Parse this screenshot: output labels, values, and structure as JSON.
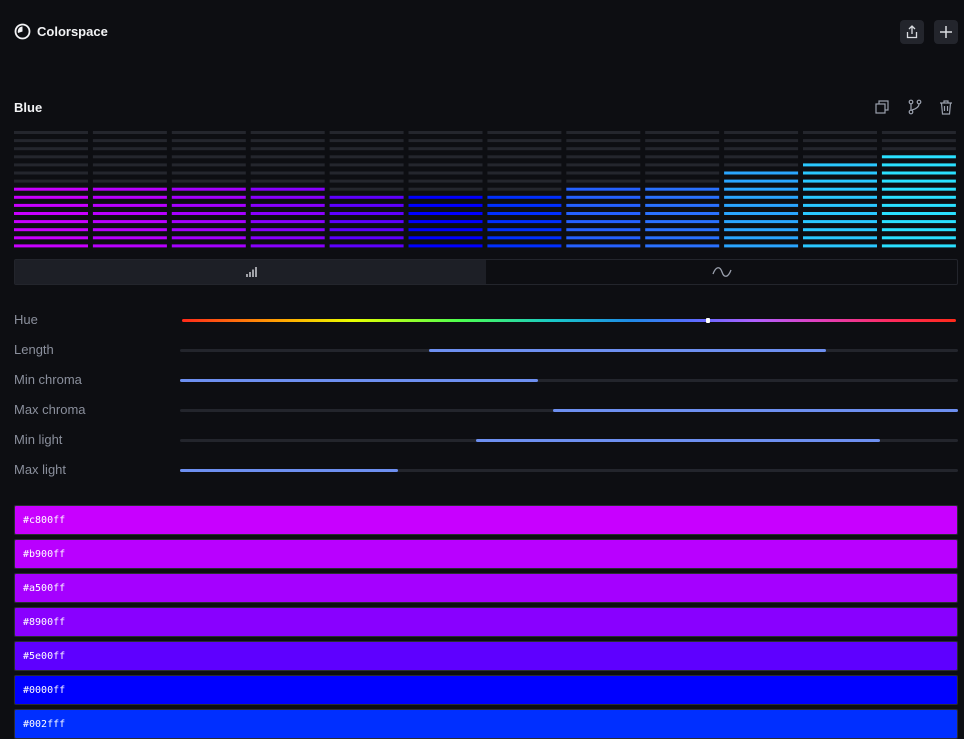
{
  "app": {
    "title": "Colorspace"
  },
  "toolbar": {
    "share_icon": "share-icon",
    "add_icon": "plus-icon"
  },
  "palette": {
    "name": "Blue",
    "tools": [
      "duplicate-icon",
      "fork-icon",
      "trash-icon"
    ],
    "colors": [
      "#c800ff",
      "#b900ff",
      "#a500ff",
      "#8900ff",
      "#5e00ff",
      "#0000ff",
      "#002fff",
      "#2561ff",
      "#2a71ff",
      "#2aa6ff",
      "#2ac8ff",
      "#2ae0ff"
    ],
    "levels": [
      0.55,
      0.55,
      0.55,
      0.5,
      0.45,
      0.45,
      0.45,
      0.5,
      0.5,
      0.65,
      0.75,
      0.8
    ]
  },
  "view_toggle": {
    "active": "bars",
    "options": [
      "bars-icon",
      "curve-icon"
    ]
  },
  "sliders": [
    {
      "label": "Hue",
      "type": "hue",
      "value": 0.68
    },
    {
      "label": "Length",
      "range": [
        0.32,
        0.83
      ]
    },
    {
      "label": "Min chroma",
      "range": [
        0.0,
        0.46
      ]
    },
    {
      "label": "Max chroma",
      "range": [
        0.48,
        1.0
      ]
    },
    {
      "label": "Min light",
      "range": [
        0.38,
        0.9
      ]
    },
    {
      "label": "Max light",
      "range": [
        0.0,
        0.28
      ]
    }
  ],
  "swatches": [
    {
      "hex": "#c800ff"
    },
    {
      "hex": "#b900ff"
    },
    {
      "hex": "#a500ff"
    },
    {
      "hex": "#8900ff"
    },
    {
      "hex": "#5e00ff"
    },
    {
      "hex": "#0000ff"
    },
    {
      "hex": "#002fff"
    }
  ]
}
